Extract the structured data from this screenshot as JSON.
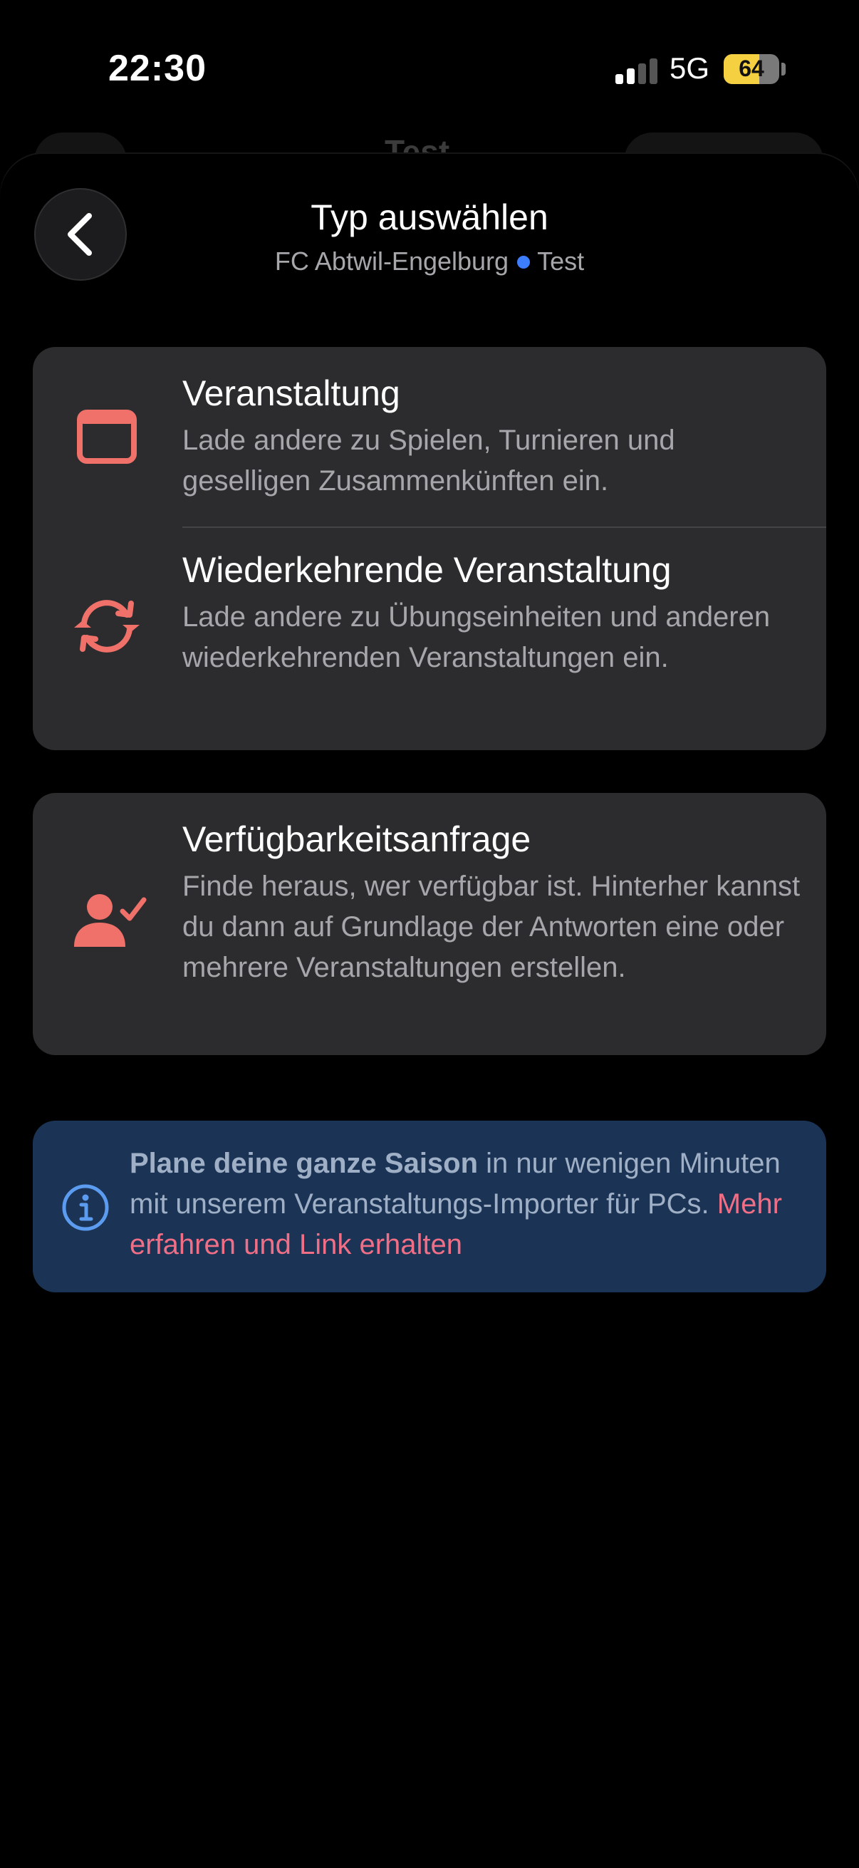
{
  "status_bar": {
    "time": "22:30",
    "network": "5G",
    "battery": "64",
    "battery_level": 0.64
  },
  "background_screen": {
    "title": "Test"
  },
  "header": {
    "title": "Typ auswählen",
    "club": "FC Abtwil-Engelburg",
    "team": "Test"
  },
  "options": [
    {
      "title": "Veranstaltung",
      "description": "Lade andere zu Spielen, Turnieren und geselligen Zusammenkünften ein.",
      "icon": "calendar-icon"
    },
    {
      "title": "Wiederkehrende Veranstaltung",
      "description": "Lade andere zu Übungseinheiten und anderen wiederkehrenden Veranstaltungen ein.",
      "icon": "repeat-icon"
    },
    {
      "title": "Verfügbarkeitsanfrage",
      "description": "Finde heraus, wer verfügbar ist. Hinterher kannst du dann auf Grundlage der Antworten eine oder mehrere Veranstaltungen erstellen.",
      "icon": "person-check-icon"
    }
  ],
  "info_banner": {
    "bold_text": "Plane deine ganze Saison",
    "text": " in nur wenigen Minuten mit unserem Veranstaltungs-Importer für PCs. ",
    "link_text": "Mehr erfahren und Link erhalten",
    "icon": "info-icon"
  },
  "colors": {
    "accent": "#f0706a",
    "link": "#f06f86",
    "team_dot": "#3d7eff",
    "card": "#2c2c2e",
    "info_bg": "#1b3354"
  }
}
